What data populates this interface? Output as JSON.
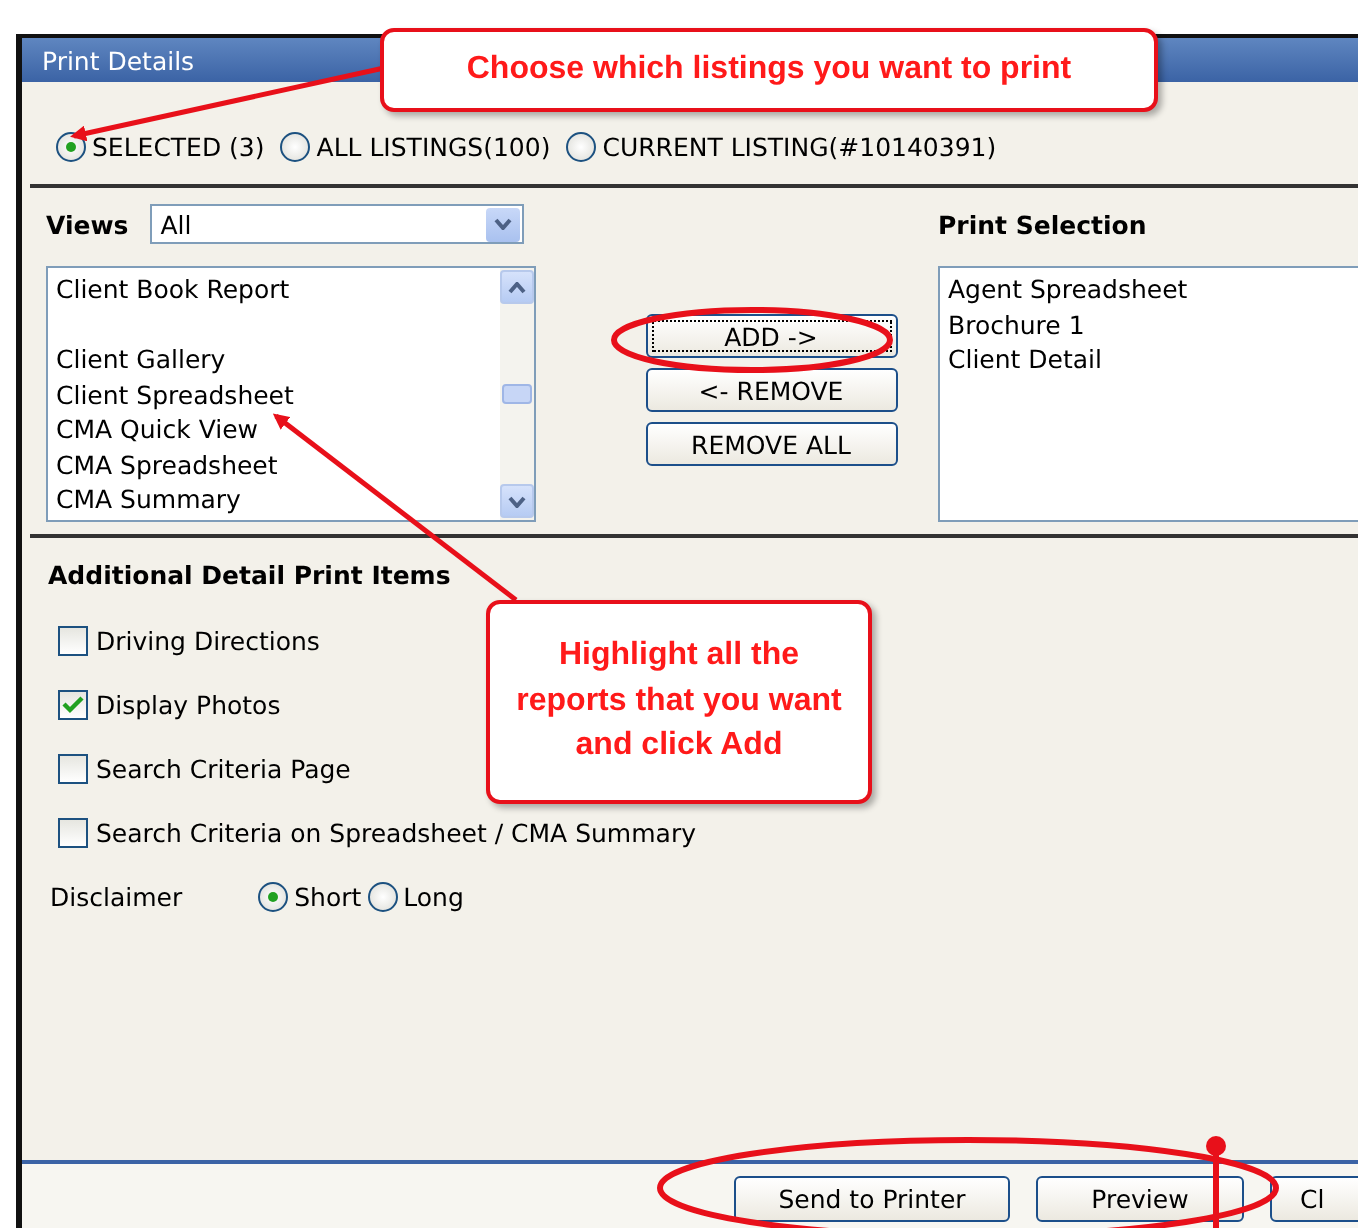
{
  "window": {
    "title": "Print Details"
  },
  "listing_scope": [
    {
      "label": "SELECTED (3)",
      "selected": true
    },
    {
      "label": "ALL LISTINGS(100)",
      "selected": false
    },
    {
      "label": "CURRENT LISTING(#10140391)",
      "selected": false
    }
  ],
  "views": {
    "label": "Views",
    "value": "All"
  },
  "available_reports": [
    {
      "label": "Client Book Report",
      "blank_above": false
    },
    {
      "label": "Client Gallery",
      "blank_above": true
    },
    {
      "label": "Client Spreadsheet",
      "blank_above": false
    },
    {
      "label": "CMA Quick View",
      "blank_above": false
    },
    {
      "label": "CMA Spreadsheet",
      "blank_above": false
    },
    {
      "label": "CMA Summary",
      "blank_above": false
    }
  ],
  "transfer_buttons": [
    {
      "label": "ADD ->",
      "focused": true
    },
    {
      "label": "<- REMOVE",
      "focused": false
    },
    {
      "label": "REMOVE ALL",
      "focused": false
    }
  ],
  "print_selection": {
    "label": "Print Selection",
    "items": [
      "Agent Spreadsheet",
      "Brochure 1",
      "Client Detail"
    ]
  },
  "additional": {
    "title": "Additional Detail Print Items",
    "items": [
      {
        "label": "Driving Directions",
        "checked": false
      },
      {
        "label": "Display Photos",
        "checked": true
      },
      {
        "label": "Search Criteria Page",
        "checked": false
      },
      {
        "label": "Search Criteria on Spreadsheet / CMA Summary",
        "checked": false
      }
    ]
  },
  "disclaimer": {
    "label": "Disclaimer",
    "options": [
      {
        "label": "Short",
        "selected": true
      },
      {
        "label": "Long",
        "selected": false
      }
    ]
  },
  "footer_buttons": [
    "Send to Printer",
    "Preview",
    "Cl"
  ],
  "annotations": [
    {
      "text": "Choose which listings you want to print"
    },
    {
      "text": "Highlight all the reports that you want and click Add"
    }
  ]
}
